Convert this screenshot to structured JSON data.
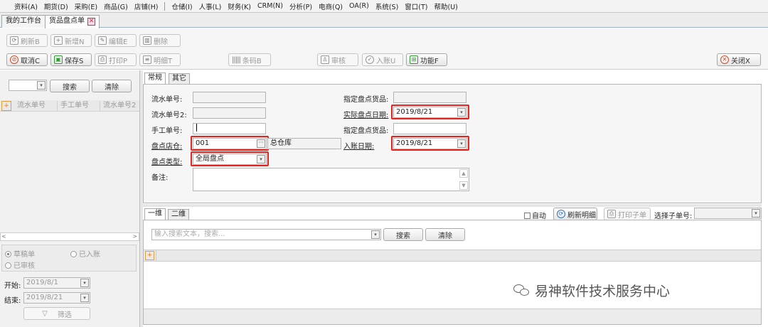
{
  "menubar": {
    "items": [
      "资料(A)",
      "期货(D)",
      "采购(E)",
      "商品(G)",
      "店铺(H)",
      "仓储(I)",
      "人事(L)",
      "财务(K)",
      "CRM(N)",
      "分析(P)",
      "电商(Q)",
      "OA(R)",
      "系统(S)",
      "窗口(T)",
      "帮助(U)"
    ]
  },
  "tabs": {
    "home": "我的工作台",
    "current": "货品盘点单"
  },
  "toolbar": {
    "refresh": "刷新B",
    "new": "新增N",
    "edit": "编辑E",
    "delete": "删除",
    "cancel": "取消C",
    "save": "保存S",
    "print": "打印P",
    "detail": "明细T",
    "barcode": "条码B",
    "audit": "审核",
    "post": "入账U",
    "function": "功能F",
    "close": "关闭X"
  },
  "left": {
    "search": "搜索",
    "clear": "清除",
    "col1": "流水单号",
    "col2": "手工单号",
    "col3": "流水单号2",
    "radio_draft": "草稿单",
    "radio_posted": "已入账",
    "radio_audited": "已审核",
    "start_label": "开始:",
    "start_value": "2019/8/1",
    "end_label": "结束:",
    "end_value": "2019/8/21",
    "filter": "筛选"
  },
  "form": {
    "tab_general": "常规",
    "tab_other": "其它",
    "serial_label": "流水单号:",
    "serial_value": "",
    "serial2_label": "流水单号2:",
    "serial2_value": "",
    "manual_label": "手工单号:",
    "manual_value": "",
    "store_label": "盘点店仓:",
    "store_value": "001",
    "store_name": "总仓库",
    "type_label": "盘点类型:",
    "type_value": "全局盘点",
    "note_label": "备注:",
    "note_value": "",
    "goods_label": "指定盘点货品:",
    "goods_value": "",
    "actual_date_label": "实际盘点日期:",
    "actual_date_value": "2019/8/21",
    "goods2_label": "指定盘点货品:",
    "goods2_value": "",
    "entry_date_label": "入账日期:",
    "entry_date_value": "2019/8/21"
  },
  "bottom": {
    "tab_1d": "一维",
    "tab_2d": "二维",
    "auto": "自动",
    "refresh_detail": "刷新明细",
    "print_sub": "打印子单",
    "select_sub": "选择子单号:",
    "search_placeholder": "输入搜索文本，搜索...",
    "search": "搜索",
    "clear": "清除"
  },
  "watermark": "易神软件技术服务中心"
}
